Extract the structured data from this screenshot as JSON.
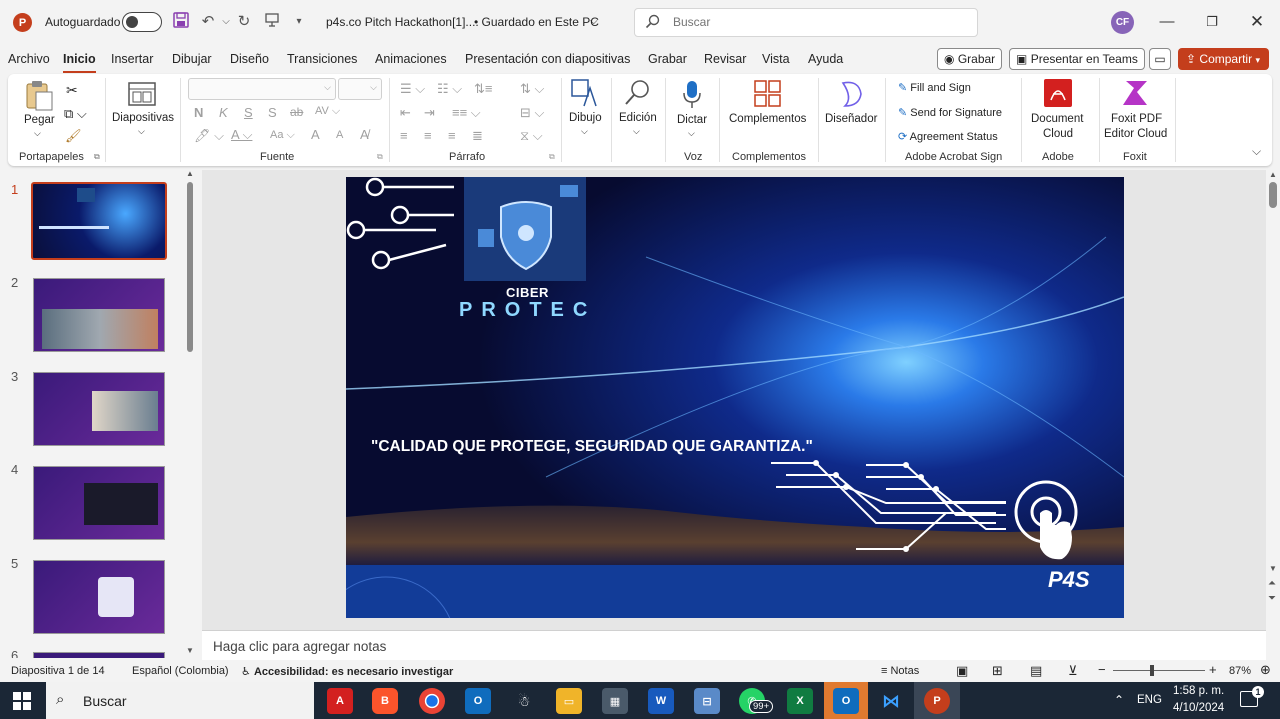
{
  "titlebar": {
    "logo": "P",
    "autosave_label": "Autoguardado",
    "doc_title": "p4s.co Pitch Hackathon[1]....",
    "save_status": "• Guardado en Este PC",
    "search_placeholder": "Buscar",
    "avatar_initials": "CF"
  },
  "menu": {
    "tabs": [
      "Archivo",
      "Inicio",
      "Insertar",
      "Dibujar",
      "Diseño",
      "Transiciones",
      "Animaciones",
      "Presentación con diapositivas",
      "Grabar",
      "Revisar",
      "Vista",
      "Ayuda"
    ],
    "active": "Inicio",
    "record": "Grabar",
    "present_teams": "Presentar en Teams",
    "share": "Compartir"
  },
  "ribbon": {
    "paste": "Pegar",
    "slides": "Diapositivas",
    "drawing": "Dibujo",
    "editing": "Edición",
    "dictate": "Dictar",
    "addins": "Complementos",
    "designer": "Diseñador",
    "fill_sign": "Fill and Sign",
    "send_signature": "Send for Signature",
    "agreement_status": "Agreement Status",
    "doc_cloud_1": "Document",
    "doc_cloud_2": "Cloud",
    "foxit_1": "Foxit PDF",
    "foxit_2": "Editor Cloud",
    "groups": {
      "clipboard": "Portapapeles",
      "font": "Fuente",
      "paragraph": "Párrafo",
      "voice": "Voz",
      "addins": "Complementos",
      "acrobat": "Adobe Acrobat Sign",
      "adobe": "Adobe",
      "foxit": "Foxit"
    },
    "font_buttons": {
      "bold": "N",
      "italic": "K",
      "underline": "S",
      "strike": "S",
      "grow": "A",
      "shrink": "A",
      "case": "Aa"
    }
  },
  "thumbnails": [
    "1",
    "2",
    "3",
    "4",
    "5",
    "6"
  ],
  "selected_slide": 1,
  "slide": {
    "logo_line1": "CIBER",
    "logo_line2": "PROTEC",
    "tagline": "\"CALIDAD QUE PROTEGE, SEGURIDAD QUE GARANTIZA.\"",
    "brand": "P4S"
  },
  "notes_placeholder": "Haga clic para agregar notas",
  "status": {
    "slide_count": "Diapositiva 1 de 14",
    "language": "Español (Colombia)",
    "accessibility": "Accesibilidad: es necesario investigar",
    "notes": "Notas",
    "zoom": "87%"
  },
  "taskbar": {
    "search": "Buscar",
    "whatsapp_badge": "99+",
    "language": "ENG",
    "time": "1:58 p. m.",
    "date": "4/10/2024",
    "notifications": "1"
  },
  "colors": {
    "accent": "#c43e1c",
    "taskbar": "#1b2736",
    "slide_bg": "#0a1240"
  }
}
